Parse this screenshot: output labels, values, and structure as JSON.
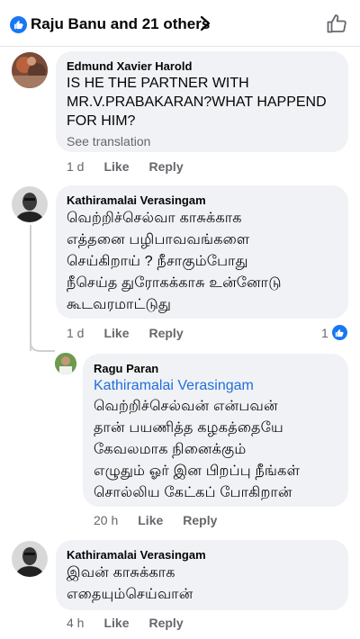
{
  "header": {
    "title": "Raju Banu and 21 others",
    "brand_color": "#1877f2"
  },
  "comments": [
    {
      "author": "Edmund Xavier Harold",
      "text_lines": [
        "IS HE THE PARTNER WITH",
        "MR.V.PRABAKARAN?WHAT HAPPEND",
        "FOR HIM?"
      ],
      "see_translation": "See translation",
      "time": "1 d",
      "like": "Like",
      "reply": "Reply"
    },
    {
      "author": "Kathiramalai Verasingam",
      "text_lines": [
        "வெற்றிச்செல்வா காசுக்காக",
        "எத்தனை பழிபாவவங்களை",
        "செய்கிறாய் ? நீசாகும்போது",
        "நீசெய்த துரோகக்காசு உன்னோடு",
        "கூடவரமாட்டுது"
      ],
      "time": "1 d",
      "like": "Like",
      "reply": "Reply",
      "reaction_count": "1"
    },
    {
      "author": "Ragu Paran",
      "mention": "Kathiramalai Verasingam",
      "text_lines": [
        "வெற்றிச்செல்வன் என்பவன்",
        "தான் பயணித்த கழகத்தையே",
        "கேவலமாக நினைக்கும்",
        "எழுதும் ஓர் இன பிறப்பு நீங்கள்",
        "சொல்லிய கேட்கப் போகிறான்"
      ],
      "time": "20 h",
      "like": "Like",
      "reply": "Reply"
    },
    {
      "author": "Kathiramalai Verasingam",
      "text_lines": [
        "இவன் காசுக்காக",
        "எதையும்செய்வான்"
      ],
      "time": "4 h",
      "like": "Like",
      "reply": "Reply"
    }
  ]
}
